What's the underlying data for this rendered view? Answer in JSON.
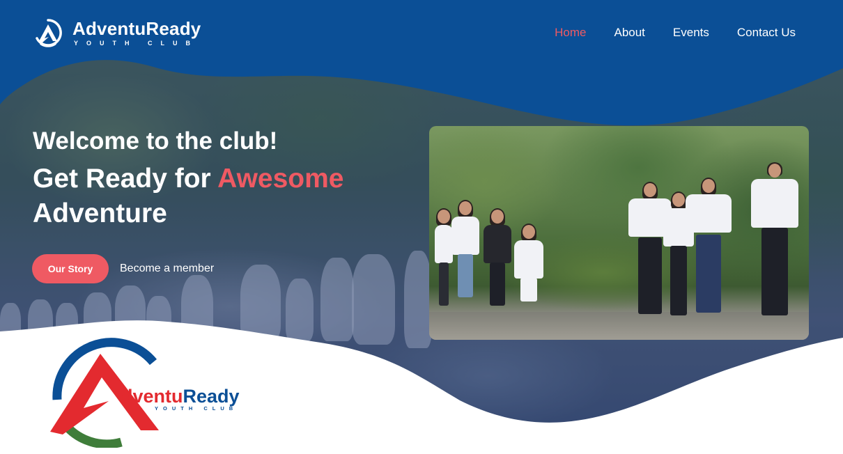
{
  "brand": {
    "name": "AdventuReady",
    "tagline": "YOUTH CLUB",
    "logo_letter_red": "A",
    "logo_rest": "dventuReady"
  },
  "nav": {
    "items": [
      {
        "label": "Home",
        "active": true
      },
      {
        "label": "About",
        "active": false
      },
      {
        "label": "Events",
        "active": false
      },
      {
        "label": "Contact Us",
        "active": false
      }
    ]
  },
  "hero": {
    "welcome": "Welcome to the club!",
    "headline_start": "Get Ready for ",
    "headline_accent": "Awesome",
    "headline_end": "Adventure",
    "primary_button": "Our Story",
    "secondary_link": "Become a member"
  },
  "colors": {
    "primary_blue": "#0b4f96",
    "accent_red": "#ef5a63",
    "logo_red": "#e32a2f",
    "logo_green": "#3f7d3a",
    "white": "#ffffff"
  },
  "icons": {
    "header_logo": "adventuready-logo-icon",
    "brand_logo": "adventuready-brand-logo"
  }
}
